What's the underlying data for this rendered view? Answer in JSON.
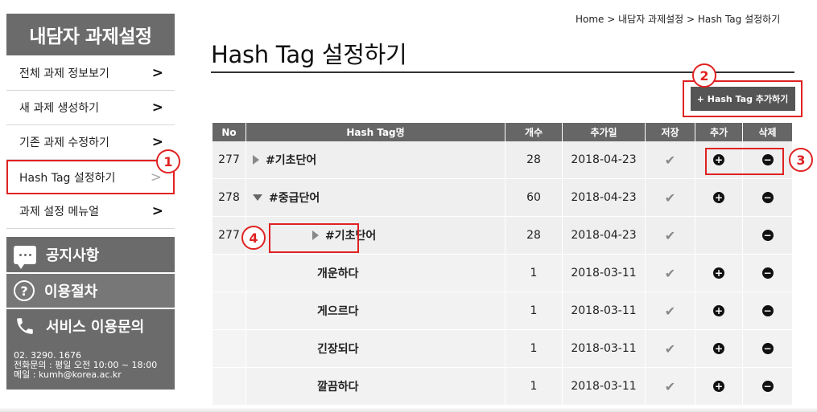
{
  "sidebar": {
    "title": "내담자 과제설정",
    "items": [
      {
        "label": "전체 과제 정보보기",
        "chevron": ">"
      },
      {
        "label": "새 과제 생성하기",
        "chevron": ">"
      },
      {
        "label": "기존 과제 수정하기",
        "chevron": ">"
      },
      {
        "label": "Hash Tag 설정하기",
        "chevron": ">"
      },
      {
        "label": "과제 설정 메뉴얼",
        "chevron": ">"
      }
    ],
    "notice": "공지사항",
    "procedure": "이용절차",
    "inquiry": "서비스 이용문의",
    "contact_phone": "02. 3290. 1676",
    "contact_hours": "전화문의 : 평일 오전 10:00 ~ 18:00",
    "contact_email": "메일 : kumh@korea.ac.kr"
  },
  "breadcrumb": "Home > 내담자 과제설정 > Hash Tag 설정하기",
  "page_title": "Hash Tag 설정하기",
  "add_button": "+ Hash Tag 추가하기",
  "table": {
    "headers": {
      "no": "No",
      "tag": "Hash Tag명",
      "count": "개수",
      "date": "추가일",
      "save": "저장",
      "add": "추가",
      "delete": "삭제"
    },
    "rows": [
      {
        "no": "277",
        "tag": "#기초단어",
        "count": "28",
        "date": "2018-04-23"
      },
      {
        "no": "278",
        "tag": "#중급단어",
        "count": "60",
        "date": "2018-04-23"
      },
      {
        "no": "277",
        "tag": "#기초단어",
        "count": "28",
        "date": "2018-04-23"
      },
      {
        "no": "",
        "tag": "개운하다",
        "count": "1",
        "date": "2018-03-11"
      },
      {
        "no": "",
        "tag": "게으르다",
        "count": "1",
        "date": "2018-03-11"
      },
      {
        "no": "",
        "tag": "긴장되다",
        "count": "1",
        "date": "2018-03-11"
      },
      {
        "no": "",
        "tag": "깔끔하다",
        "count": "1",
        "date": "2018-03-11"
      }
    ]
  },
  "badges": {
    "b1": "1",
    "b2": "2",
    "b3": "3",
    "b4": "4"
  },
  "colors": {
    "accent": "#e02222",
    "sidebar_bg": "#6b6b6b",
    "header_bg": "#666666"
  }
}
